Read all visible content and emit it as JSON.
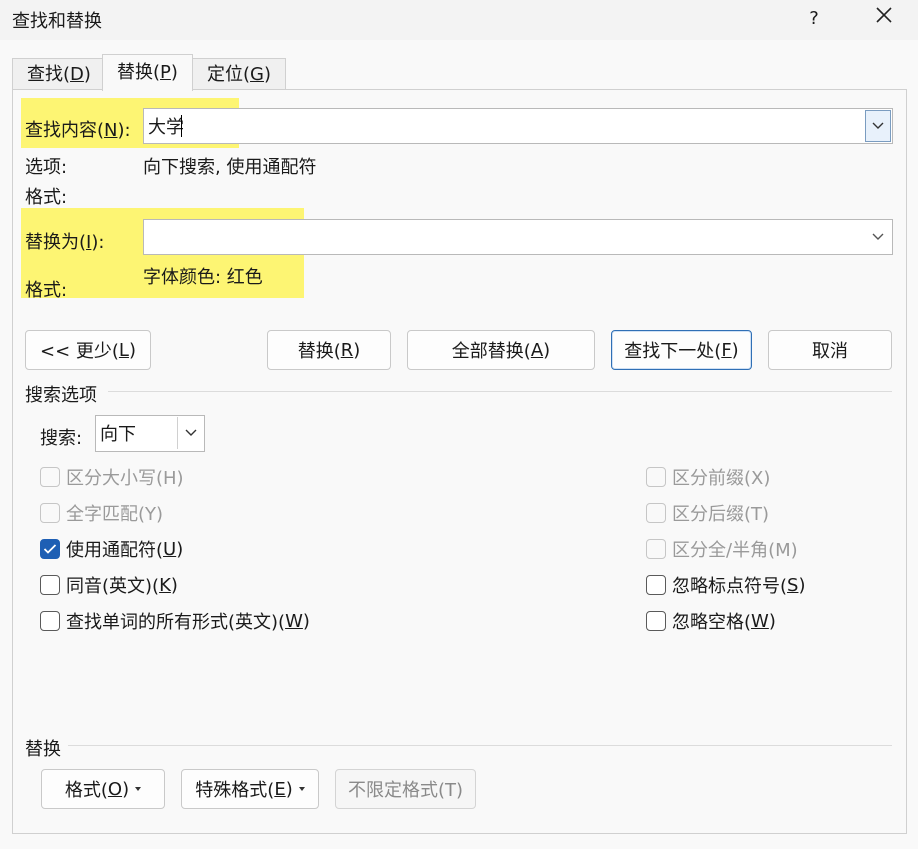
{
  "window": {
    "title": "查找和替换",
    "help": "?",
    "close_icon": "close-icon"
  },
  "tabs": [
    {
      "label": "查找(",
      "key": "D",
      "suffix": ")"
    },
    {
      "label": "替换(",
      "key": "P",
      "suffix": ")"
    },
    {
      "label": "定位(",
      "key": "G",
      "suffix": ")"
    }
  ],
  "find": {
    "label_prefix": "查找内容(",
    "key": "N",
    "label_suffix": "):",
    "value": "大学",
    "options_label": "选项:",
    "options_value": "向下搜索, 使用通配符",
    "format_label": "格式:"
  },
  "replace": {
    "label_prefix": "替换为(",
    "key": "I",
    "label_suffix": "):",
    "value": "",
    "format_label": "格式:",
    "format_value": "字体颜色: 红色"
  },
  "highlight_color": "#fdf573",
  "buttons": {
    "less": {
      "prefix": "<< 更少(",
      "key": "L",
      "suffix": ")"
    },
    "replace": {
      "prefix": "替换(",
      "key": "R",
      "suffix": ")"
    },
    "replace_all": {
      "prefix": "全部替换(",
      "key": "A",
      "suffix": ")"
    },
    "find_next": {
      "prefix": "查找下一处(",
      "key": "F",
      "suffix": ")"
    },
    "cancel": "取消"
  },
  "search_options": {
    "heading": "搜索选项",
    "search_label": "搜索:",
    "direction": "向下",
    "left": [
      {
        "label": "区分大小写(H)",
        "checked": false,
        "disabled": true
      },
      {
        "label": "全字匹配(Y)",
        "checked": false,
        "disabled": true
      },
      {
        "prefix": "使用通配符(",
        "key": "U",
        "suffix": ")",
        "checked": true,
        "disabled": false
      },
      {
        "prefix": "同音(英文)(",
        "key": "K",
        "suffix": ")",
        "checked": false,
        "disabled": false
      },
      {
        "prefix": "查找单词的所有形式(英文)(",
        "key": "W",
        "suffix": ")",
        "checked": false,
        "disabled": false
      }
    ],
    "right": [
      {
        "label": "区分前缀(X)",
        "checked": false,
        "disabled": true
      },
      {
        "label": "区分后缀(T)",
        "checked": false,
        "disabled": true
      },
      {
        "label": "区分全/半角(M)",
        "checked": false,
        "disabled": true
      },
      {
        "prefix": "忽略标点符号(",
        "key": "S",
        "suffix": ")",
        "checked": false,
        "disabled": false
      },
      {
        "prefix": "忽略空格(",
        "key": "W",
        "suffix": ")",
        "checked": false,
        "disabled": false
      }
    ]
  },
  "replace_section": {
    "heading": "替换",
    "format_btn": {
      "prefix": "格式(",
      "key": "O",
      "suffix": ")"
    },
    "special_btn": {
      "prefix": "特殊格式(",
      "key": "E",
      "suffix": ")"
    },
    "no_format_btn": "不限定格式(T)"
  }
}
